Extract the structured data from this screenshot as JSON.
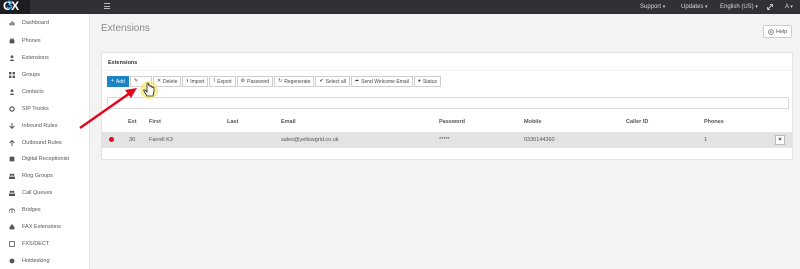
{
  "app": {
    "logo_text": "3CX",
    "accent": "#1c84c6",
    "topnav": [
      {
        "label": "Support",
        "caret": "▾"
      },
      {
        "label": "Updates",
        "caret": "▾"
      },
      {
        "label": "English (US)",
        "caret": "▾"
      },
      {
        "label": "A",
        "caret": "▾"
      }
    ]
  },
  "sidebar": {
    "items": [
      {
        "label": "Dashboard",
        "icon": "bar-chart-icon"
      },
      {
        "label": "Phones",
        "icon": "phone-icon"
      },
      {
        "label": "Extensions",
        "icon": "user-icon"
      },
      {
        "label": "Groups",
        "icon": "grid-icon"
      },
      {
        "label": "Contacts",
        "icon": "contact-icon"
      },
      {
        "label": "SIP Trunks",
        "icon": "gear-icon"
      },
      {
        "label": "Inbound Rules",
        "icon": "arrow-down-icon"
      },
      {
        "label": "Outbound Rules",
        "icon": "arrow-up-icon"
      },
      {
        "label": "Digital Receptionist",
        "icon": "receptionist-icon"
      },
      {
        "label": "Ring Groups",
        "icon": "group-icon"
      },
      {
        "label": "Call Queues",
        "icon": "queue-icon"
      },
      {
        "label": "Bridges",
        "icon": "bridge-icon"
      },
      {
        "label": "FAX Extensions",
        "icon": "fax-icon"
      },
      {
        "label": "FXS/DECT",
        "icon": "fxs-icon"
      },
      {
        "label": "Hotdesking",
        "icon": "hotdesk-icon"
      }
    ]
  },
  "main": {
    "title": "Extensions",
    "help_label": "Help",
    "panel_title": "Extensions",
    "toolbar": [
      {
        "label": "Add",
        "icon": "plus-icon",
        "primary": true
      },
      {
        "label": "",
        "icon": "edit-icon",
        "primary": false
      },
      {
        "label": "Delete",
        "icon": "delete-icon",
        "primary": false
      },
      {
        "label": "Import",
        "icon": "import-icon",
        "primary": false
      },
      {
        "label": "Export",
        "icon": "export-icon",
        "primary": false
      },
      {
        "label": "Password",
        "icon": "password-icon",
        "primary": false
      },
      {
        "label": "Regenerate",
        "icon": "regenerate-icon",
        "primary": false
      },
      {
        "label": "Select all",
        "icon": "check-icon",
        "primary": false
      },
      {
        "label": "Send Welcome Email",
        "icon": "send-icon",
        "primary": false
      },
      {
        "label": "Status",
        "icon": "status-icon",
        "primary": false
      }
    ],
    "search_value": "",
    "table": {
      "columns": [
        "Ext",
        "First",
        "Last",
        "Email",
        "Password",
        "Mobile",
        "Caller ID",
        "Phones"
      ],
      "rows": [
        {
          "status_color": "#e3061b",
          "ext": "30",
          "first": "Farrell K3",
          "last": "",
          "email": "sales@yellowgrid.co.uk",
          "password": "*****",
          "mobile": "0330144360",
          "caller_id": "",
          "phones": "1",
          "close_label": "×"
        }
      ]
    }
  }
}
